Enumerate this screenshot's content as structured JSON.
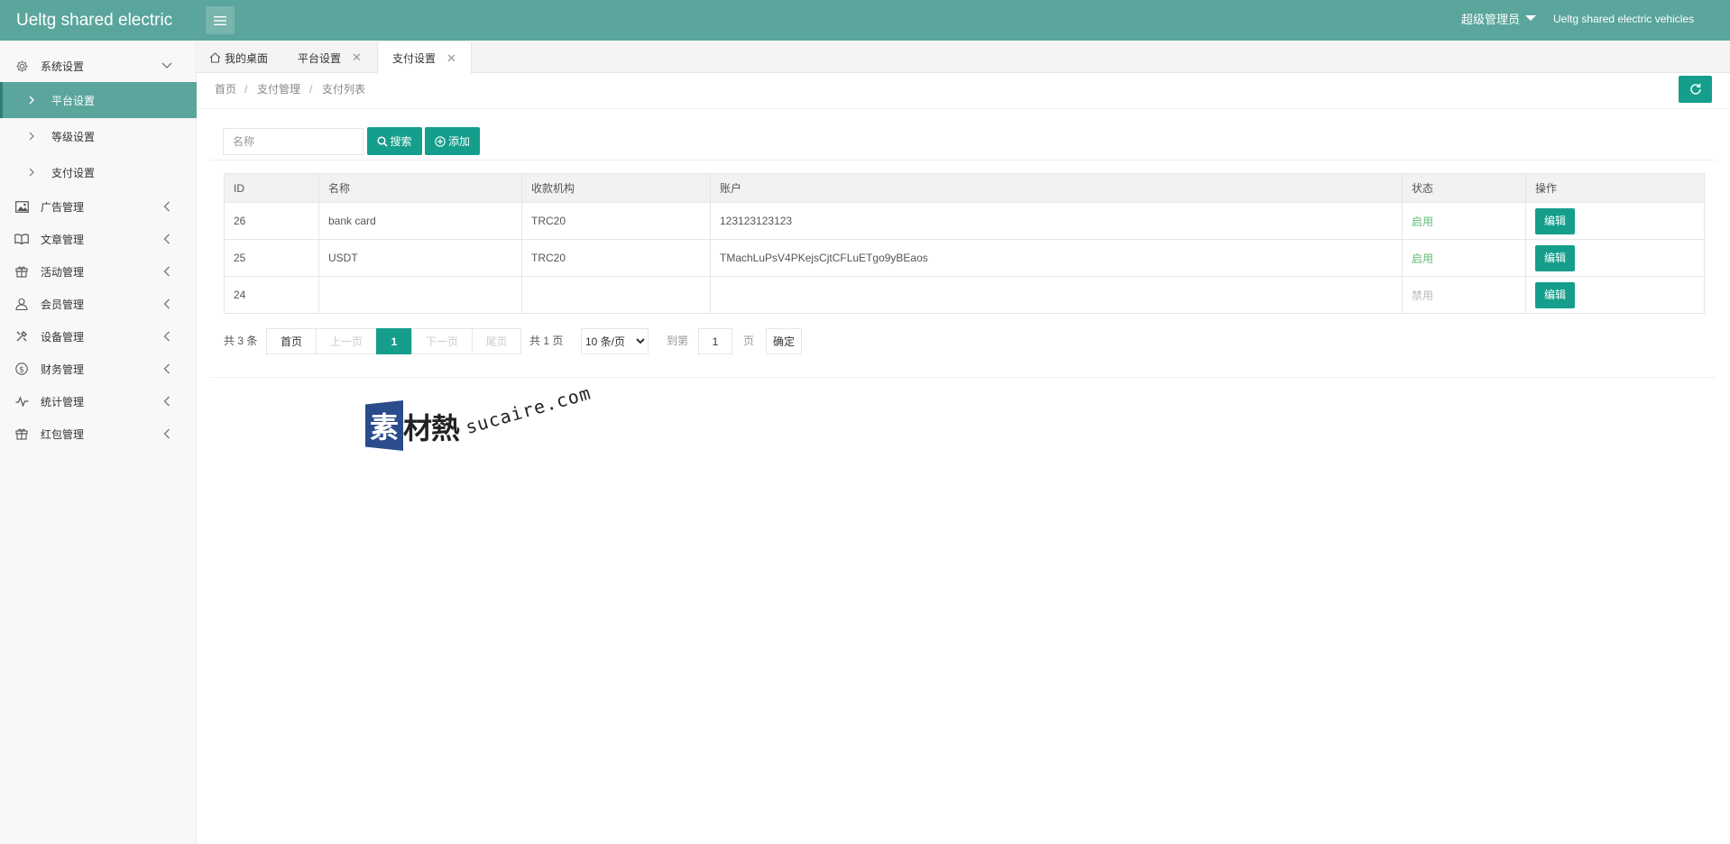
{
  "header": {
    "logo": "Ueltg shared electric",
    "user": "超级管理员",
    "site": "Ueltg shared electric vehicles"
  },
  "sidebar": {
    "groups": [
      {
        "label": "系统设置",
        "icon": "gear-icon"
      },
      {
        "label": "广告管理",
        "icon": "image-icon"
      },
      {
        "label": "文章管理",
        "icon": "book-icon"
      },
      {
        "label": "活动管理",
        "icon": "gift-icon"
      },
      {
        "label": "会员管理",
        "icon": "user-icon"
      },
      {
        "label": "设备管理",
        "icon": "tools-icon"
      },
      {
        "label": "财务管理",
        "icon": "dollar-icon"
      },
      {
        "label": "统计管理",
        "icon": "pulse-icon"
      },
      {
        "label": "红包管理",
        "icon": "gift-icon"
      }
    ],
    "sub_items": [
      {
        "label": "平台设置",
        "active": true
      },
      {
        "label": "等级设置",
        "active": false
      },
      {
        "label": "支付设置",
        "active": false
      }
    ]
  },
  "tabs": [
    {
      "label": "我的桌面",
      "icon": "home-icon"
    },
    {
      "label": "平台设置"
    },
    {
      "label": "支付设置",
      "active": true
    }
  ],
  "breadcrumb": [
    "首页",
    "支付管理",
    "支付列表"
  ],
  "toolbar": {
    "search_placeholder": "名称",
    "search_label": "搜索",
    "add_label": "添加"
  },
  "table": {
    "headers": [
      "ID",
      "名称",
      "收款机构",
      "账户",
      "状态",
      "操作"
    ],
    "rows": [
      {
        "id": "26",
        "name": "bank card",
        "org": "TRC20",
        "account": "123123123123",
        "status": "启用",
        "action": "编辑"
      },
      {
        "id": "25",
        "name": "USDT",
        "org": "TRC20",
        "account": "TMachLuPsV4PKejsCjtCFLuETgo9yBEaos",
        "status": "启用",
        "action": "编辑"
      },
      {
        "id": "24",
        "name": "",
        "org": "",
        "account": "",
        "status": "禁用",
        "action": "编辑"
      }
    ]
  },
  "pager": {
    "total": "共 3 条",
    "first": "首页",
    "prev": "上一页",
    "current": "1",
    "next": "下一页",
    "last": "尾页",
    "pages": "共 1 页",
    "page_size": "10 条/页",
    "goto_label": "到第",
    "goto_value": "1",
    "page_unit": "页",
    "confirm": "确定"
  },
  "watermark": {
    "mark": "素",
    "cn": "材熱",
    "en": "sucaire.com"
  },
  "colors": {
    "header": "#5aa59c",
    "primary": "#149e8b",
    "enabled": "#5fb878",
    "disabled": "#bbbbbb"
  }
}
